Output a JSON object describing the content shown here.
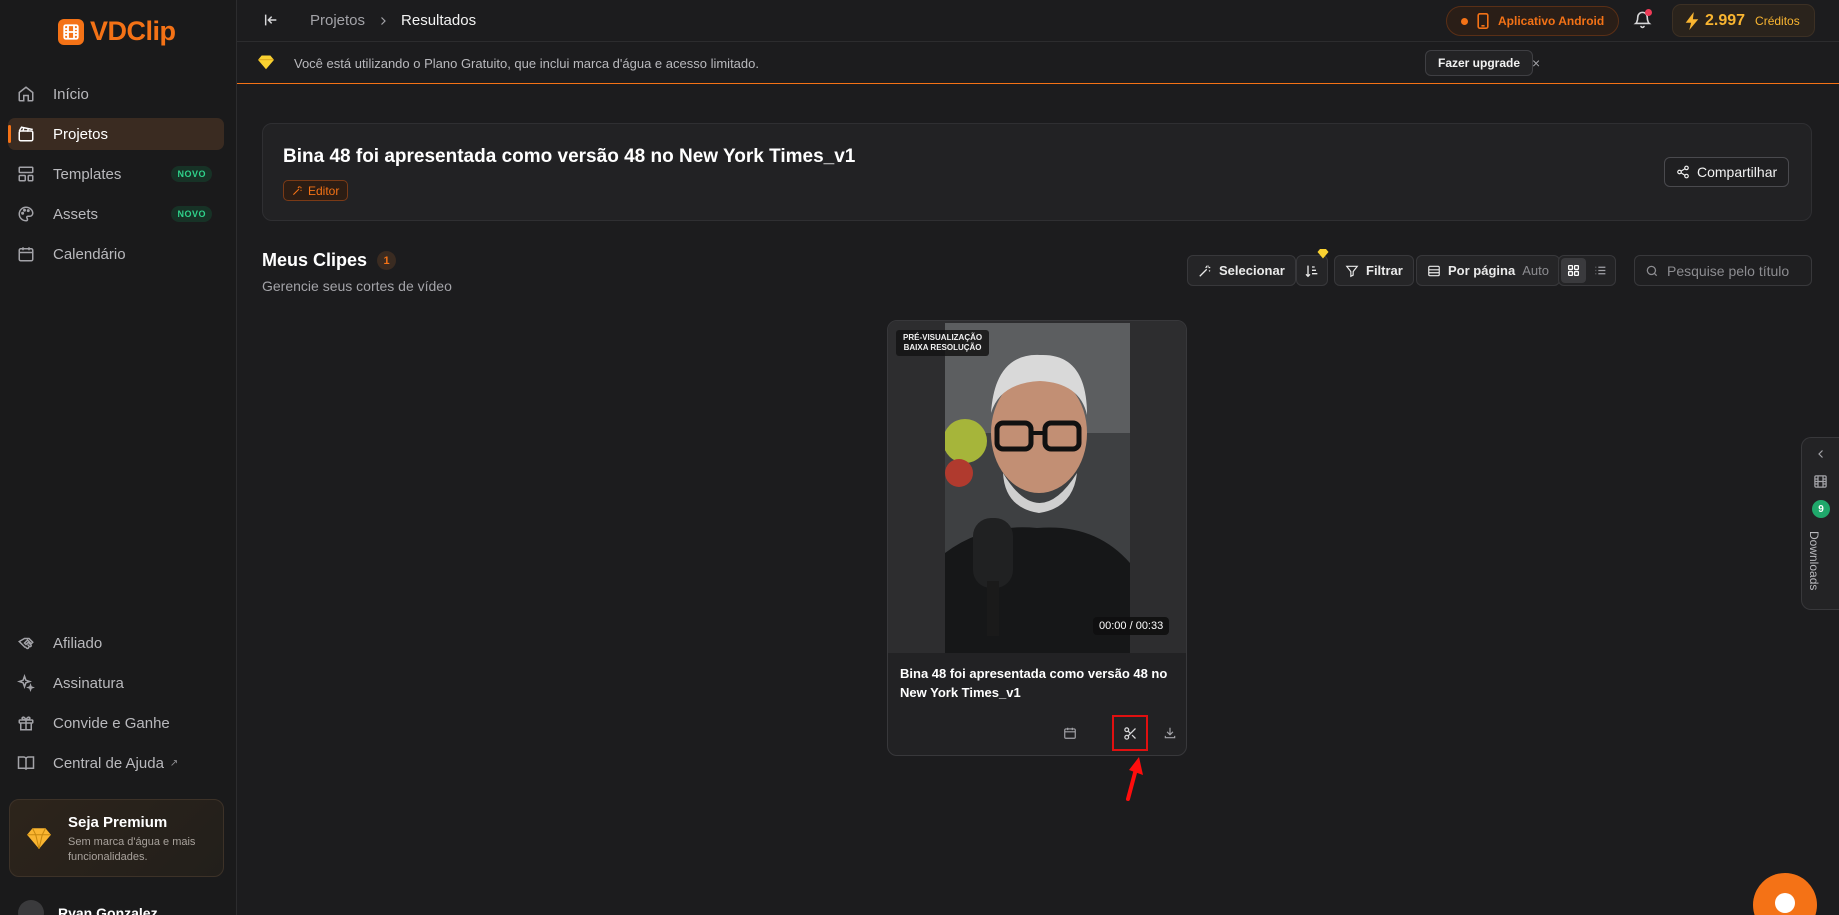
{
  "app": {
    "name": "VDClip",
    "brand_color": "#f47216"
  },
  "sidebar": {
    "main_items": [
      {
        "label": "Início",
        "icon": "home-icon"
      },
      {
        "label": "Projetos",
        "icon": "clapperboard-icon",
        "active": true
      },
      {
        "label": "Templates",
        "icon": "layout-icon",
        "badge": "NOVO"
      },
      {
        "label": "Assets",
        "icon": "palette-icon",
        "badge": "NOVO"
      },
      {
        "label": "Calendário",
        "icon": "calendar-icon"
      }
    ],
    "bottom_items": [
      {
        "label": "Afiliado",
        "icon": "handshake-icon"
      },
      {
        "label": "Assinatura",
        "icon": "sparkles-icon"
      },
      {
        "label": "Convide e Ganhe",
        "icon": "gift-icon"
      },
      {
        "label": "Central de Ajuda",
        "icon": "book-icon",
        "external": "↗"
      }
    ],
    "premium": {
      "title": "Seja Premium",
      "subtitle": "Sem marca d'água e mais funcionalidades."
    },
    "user": {
      "name": "Ryan Gonzalez"
    }
  },
  "topbar": {
    "breadcrumb": [
      "Projetos",
      "Resultados"
    ],
    "android_label": "Aplicativo Android",
    "credits_value": "2.997",
    "credits_label": "Créditos"
  },
  "banner": {
    "text": "Você está utilizando o Plano Gratuito, que inclui marca d'água e acesso limitado.",
    "upgrade_label": "Fazer upgrade",
    "close": "×"
  },
  "project": {
    "title": "Bina 48 foi apresentada como versão 48 no New York Times_v1",
    "tag": "Editor",
    "share_label": "Compartilhar"
  },
  "clips": {
    "title": "Meus Clipes",
    "count": "1",
    "subtitle": "Gerencie seus cortes de vídeo",
    "toolbar": {
      "select_label": "Selecionar",
      "filter_label": "Filtrar",
      "per_page_label": "Por página",
      "per_page_value": "Auto"
    },
    "search_placeholder": "Pesquise pelo título",
    "items": [
      {
        "preview_label_1": "PRÉ-VISUALIZAÇÃO",
        "preview_label_2": "BAIXA RESOLUÇÃO",
        "timecode": "00:00 / 00:33",
        "title": "Bina 48 foi apresentada como versão 48 no New York Times_v1"
      }
    ]
  },
  "downloads": {
    "label": "Downloads",
    "count": "9"
  }
}
